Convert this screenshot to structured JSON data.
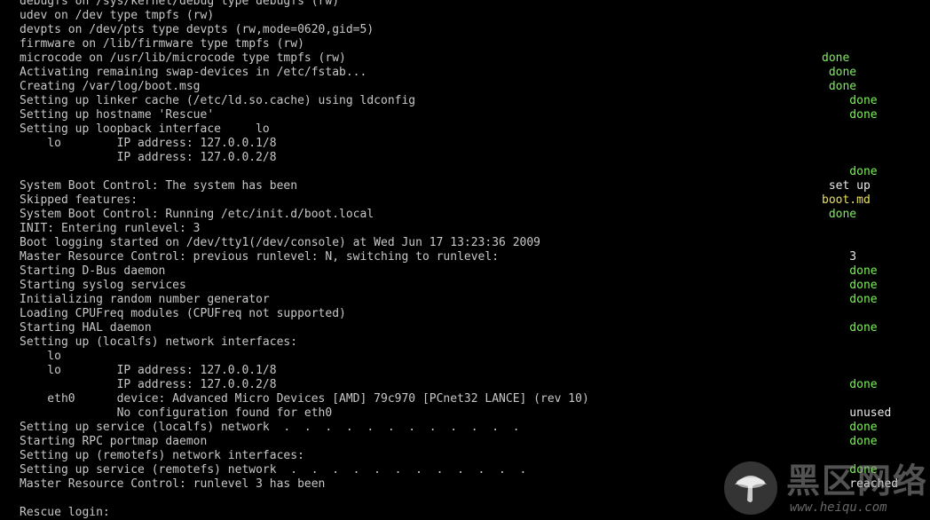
{
  "console": {
    "lines": [
      {
        "text": "debugfs on /sys/kernel/debug type debugfs (rw)",
        "status": "",
        "status_color": ""
      },
      {
        "text": "udev on /dev type tmpfs (rw)",
        "status": "",
        "status_color": ""
      },
      {
        "text": "devpts on /dev/pts type devpts (rw,mode=0620,gid=5)",
        "status": "",
        "status_color": ""
      },
      {
        "text": "firmware on /lib/firmware type tmpfs (rw)",
        "status": "",
        "status_color": ""
      },
      {
        "text": "microcode on /usr/lib/microcode type tmpfs (rw)",
        "status": "done",
        "status_color": "green"
      },
      {
        "text": "Activating remaining swap-devices in /etc/fstab...",
        "status": " done",
        "status_color": "green"
      },
      {
        "text": "Creating /var/log/boot.msg",
        "status": " done",
        "status_color": "green"
      },
      {
        "text": "Setting up linker cache (/etc/ld.so.cache) using ldconfig",
        "status": "    done",
        "status_color": "green"
      },
      {
        "text": "Setting up hostname 'Rescue'",
        "status": "    done",
        "status_color": "green"
      },
      {
        "text": "Setting up loopback interface     lo",
        "status": "",
        "status_color": ""
      },
      {
        "text": "    lo        IP address: 127.0.0.1/8",
        "status": "",
        "status_color": ""
      },
      {
        "text": "              IP address: 127.0.0.2/8",
        "status": "",
        "status_color": ""
      },
      {
        "text": "",
        "status": "    done",
        "status_color": "green"
      },
      {
        "text": "System Boot Control: The system has been",
        "status": " set up",
        "status_color": "white"
      },
      {
        "text": "Skipped features:",
        "status": "boot.md",
        "status_color": "yellow"
      },
      {
        "text": "System Boot Control: Running /etc/init.d/boot.local",
        "status": " done",
        "status_color": "green"
      },
      {
        "text": "INIT: Entering runlevel: 3",
        "status": "",
        "status_color": ""
      },
      {
        "text": "Boot logging started on /dev/tty1(/dev/console) at Wed Jun 17 13:23:36 2009",
        "status": "",
        "status_color": ""
      },
      {
        "text": "Master Resource Control: previous runlevel: N, switching to runlevel:",
        "status": "    3",
        "status_color": "white"
      },
      {
        "text": "Starting D-Bus daemon",
        "status": "    done",
        "status_color": "green"
      },
      {
        "text": "Starting syslog services",
        "status": "    done",
        "status_color": "green"
      },
      {
        "text": "Initializing random number generator",
        "status": "    done",
        "status_color": "green"
      },
      {
        "text": "Loading CPUFreq modules (CPUFreq not supported)",
        "status": "",
        "status_color": ""
      },
      {
        "text": "Starting HAL daemon",
        "status": "    done",
        "status_color": "green"
      },
      {
        "text": "Setting up (localfs) network interfaces:",
        "status": "",
        "status_color": ""
      },
      {
        "text": "    lo",
        "status": "",
        "status_color": ""
      },
      {
        "text": "    lo        IP address: 127.0.0.1/8",
        "status": "",
        "status_color": ""
      },
      {
        "text": "              IP address: 127.0.0.2/8",
        "status": "    done",
        "status_color": "green"
      },
      {
        "text": "    eth0      device: Advanced Micro Devices [AMD] 79c970 [PCnet32 LANCE] (rev 10)",
        "status": "",
        "status_color": ""
      },
      {
        "text": "              No configuration found for eth0",
        "status": "    unused",
        "status_color": "white"
      },
      {
        "text": "Setting up service (localfs) network  .  .  .  .  .  .  .  .  .  .  .  .",
        "status": "    done",
        "status_color": "green"
      },
      {
        "text": "Starting RPC portmap daemon",
        "status": "    done",
        "status_color": "green"
      },
      {
        "text": "Setting up (remotefs) network interfaces:",
        "status": "",
        "status_color": ""
      },
      {
        "text": "Setting up service (remotefs) network  .  .  .  .  .  .  .  .  .  .  .  .",
        "status": "    done",
        "status_color": "green"
      },
      {
        "text": "Master Resource Control: runlevel 3 has been",
        "status": "    reached",
        "status_color": "white"
      },
      {
        "text": "",
        "status": "",
        "status_color": ""
      },
      {
        "text": "Rescue login:",
        "status": "",
        "status_color": ""
      }
    ]
  },
  "watermark": {
    "title": "黑区网络",
    "url": "www.heiqu.com"
  },
  "colors": {
    "background": "#000000",
    "text": "#c8c8c8",
    "green": "#7cf05a",
    "white": "#e8e8e8",
    "yellow": "#e8e060"
  }
}
